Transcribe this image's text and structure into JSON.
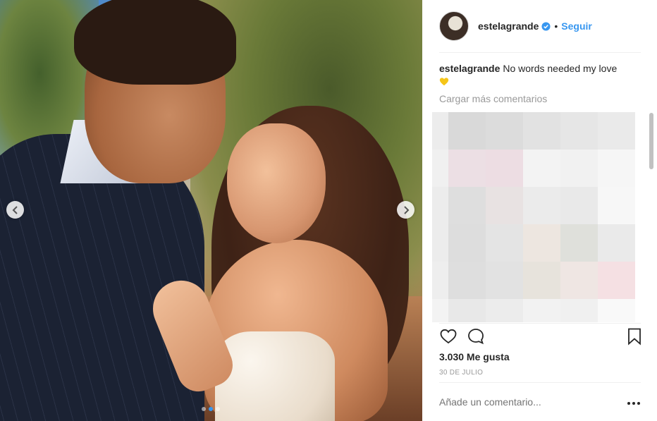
{
  "post": {
    "username": "estelagrande",
    "separator": "•",
    "follow_label": "Seguir",
    "caption_user": "estelagrande",
    "caption_text": "No words needed my love",
    "caption_emoji": "yellow-heart-emoji",
    "load_more_label": "Cargar más comentarios",
    "likes_label": "3.030 Me gusta",
    "date_label": "30 DE JULIO",
    "comment_placeholder": "Añade un comentario..."
  },
  "carousel": {
    "slide_count": 3,
    "active_slide": 2
  },
  "colors": {
    "accent": "#3897f0",
    "text": "#262626",
    "muted": "#999999",
    "divider": "#efefef"
  },
  "icons": {
    "verified": "verified-badge-icon",
    "like": "heart-icon",
    "comment": "comment-bubble-icon",
    "save": "bookmark-icon",
    "more": "more-options-icon",
    "prev": "chevron-left-icon",
    "next": "chevron-right-icon"
  }
}
